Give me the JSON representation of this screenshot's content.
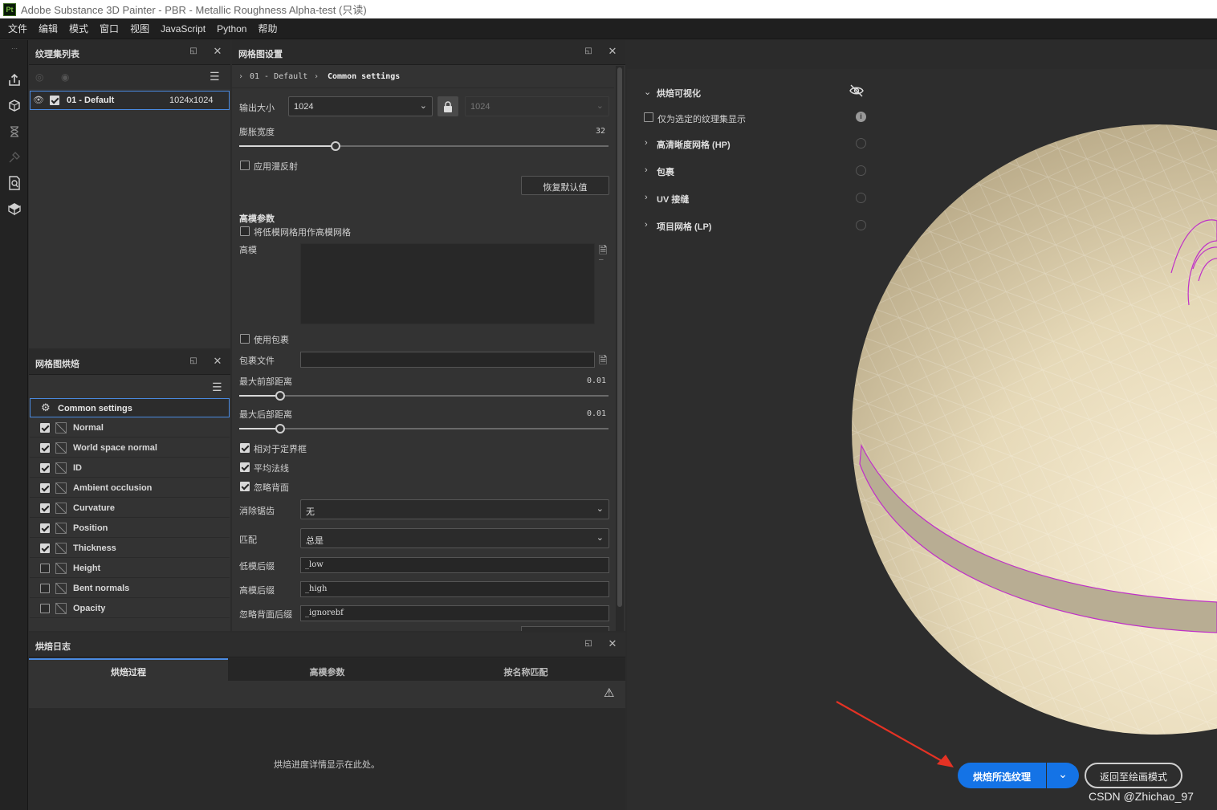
{
  "window": {
    "title": "Adobe Substance 3D Painter - PBR - Metallic Roughness Alpha-test (只读)",
    "app_icon": "Pt"
  },
  "menu": [
    "文件",
    "编辑",
    "模式",
    "窗口",
    "视图",
    "JavaScript",
    "Python",
    "帮助"
  ],
  "toolstrip": {
    "icons": [
      "export-icon",
      "bake-mesh-icon",
      "hourglass-icon",
      "paint-icon",
      "document-search-icon",
      "cube-icon"
    ]
  },
  "texture_set_list": {
    "title": "纹理集列表",
    "item": {
      "name": "01 - Default",
      "resolution": "1024x1024"
    }
  },
  "bake_list": {
    "title": "网格图烘焙",
    "common_settings": "Common settings",
    "items": [
      {
        "label": "Normal",
        "checked": true
      },
      {
        "label": "World space normal",
        "checked": true
      },
      {
        "label": "ID",
        "checked": true
      },
      {
        "label": "Ambient occlusion",
        "checked": true
      },
      {
        "label": "Curvature",
        "checked": true
      },
      {
        "label": "Position",
        "checked": true
      },
      {
        "label": "Thickness",
        "checked": true
      },
      {
        "label": "Height",
        "checked": false
      },
      {
        "label": "Bent normals",
        "checked": false
      },
      {
        "label": "Opacity",
        "checked": false
      }
    ]
  },
  "mesh_settings": {
    "title": "网格图设置",
    "breadcrumb": {
      "part1": "01 - Default",
      "part2": "Common settings"
    },
    "output_size_label": "输出大小",
    "output_size_value": "1024",
    "output_size_value2": "1024",
    "dilation_label": "膨胀宽度",
    "dilation_value": "32",
    "dilation_fraction": 0.26,
    "apply_diffusion_label": "应用漫反射",
    "reset_button": "恢复默认值",
    "high_poly_section": "高模参数",
    "use_low_as_high_label": "将低模网格用作高模网格",
    "high_poly_label": "高模",
    "use_cage_label": "使用包裹",
    "cage_file_label": "包裹文件",
    "max_front_label": "最大前部距离",
    "max_front_value": "0.01",
    "max_front_fraction": 0.11,
    "max_rear_label": "最大后部距离",
    "max_rear_value": "0.01",
    "max_rear_fraction": 0.11,
    "relative_bbox_label": "相对于定界框",
    "average_normals_label": "平均法线",
    "ignore_backface_label": "忽略背面",
    "antialias_label": "消除锯齿",
    "antialias_value": "无",
    "match_label": "匹配",
    "match_value": "总是",
    "low_suffix_label": "低模后缀",
    "low_suffix_value": "_low",
    "high_suffix_label": "高模后缀",
    "high_suffix_value": "_high",
    "ignore_suffix_label": "忽略背面后缀",
    "ignore_suffix_value": "_ignorebf"
  },
  "bake_log": {
    "title": "烘焙日志",
    "tabs": [
      "烘焙过程",
      "高模参数",
      "按名称匹配"
    ],
    "message": "烘焙进度详情显示在此处。"
  },
  "viewport": {
    "bake_visualization": "烘焙可视化",
    "only_selected_label": "仅为选定的纹理集显示",
    "sections": [
      "高清晰度网格 (HP)",
      "包裹",
      "UV 接缝",
      "项目网格 (LP)"
    ],
    "bake_button": "烘焙所选纹理",
    "return_button": "返回至绘画模式",
    "watermark": "CSDN @Zhichao_97",
    "colors": {
      "accent": "#1473e6",
      "mesh": "#ddd3b8",
      "seam": "#c030c8",
      "arrow": "#e53224"
    }
  }
}
